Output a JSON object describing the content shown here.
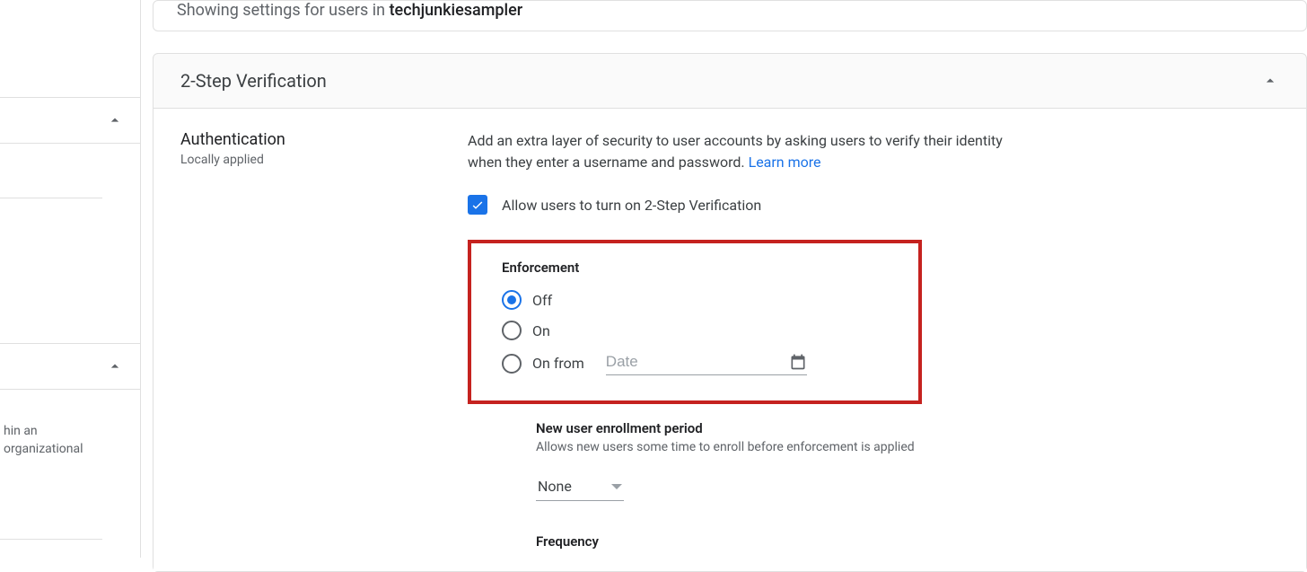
{
  "context": {
    "prefix": "Showing settings for users in ",
    "org": "techjunkiesampler"
  },
  "section": {
    "title": "2-Step Verification"
  },
  "sidebar": {
    "row3_text_1": "hin an",
    "row3_text_2": "organizational"
  },
  "auth": {
    "heading": "Authentication",
    "scope": "Locally applied",
    "description": "Add an extra layer of security to user accounts by asking users to verify their identity when they enter a username and password. ",
    "learn_more": "Learn more",
    "checkbox_label": "Allow users to turn on 2-Step Verification"
  },
  "enforcement": {
    "title": "Enforcement",
    "opt_off": "Off",
    "opt_on": "On",
    "opt_on_from": "On from",
    "date_placeholder": "Date"
  },
  "enrollment": {
    "title": "New user enrollment period",
    "desc": "Allows new users some time to enroll before enforcement is applied",
    "value": "None"
  },
  "frequency": {
    "title": "Frequency"
  }
}
